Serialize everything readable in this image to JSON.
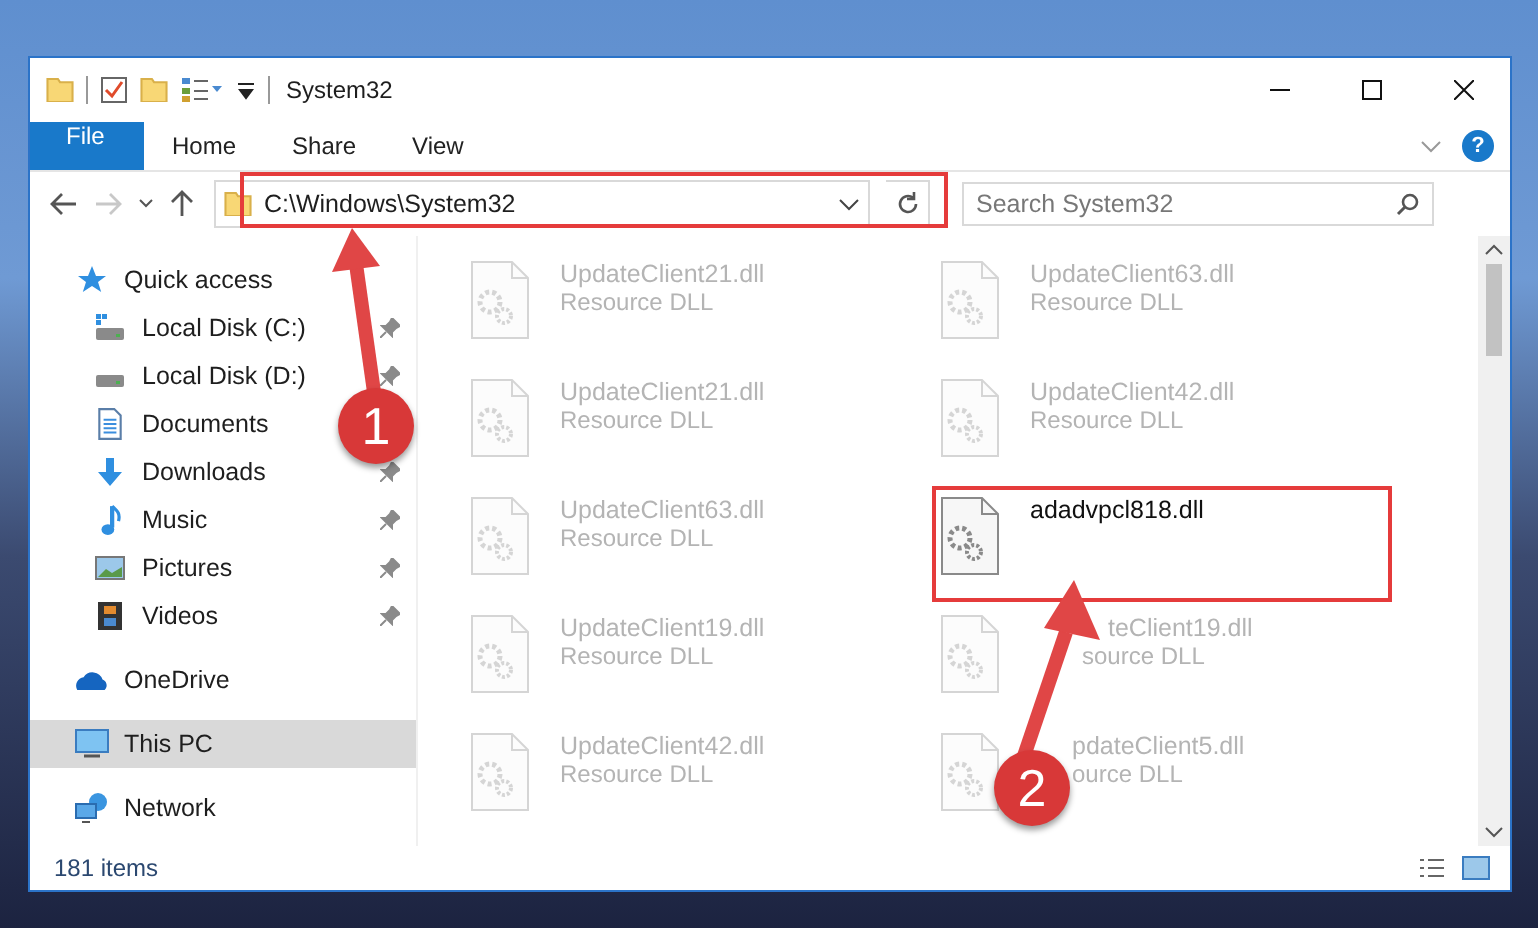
{
  "window": {
    "title": "System32"
  },
  "ribbon_tabs": [
    {
      "label": "File",
      "kind": "file-menu"
    },
    {
      "label": "Home",
      "kind": "tab"
    },
    {
      "label": "Share",
      "kind": "tab"
    },
    {
      "label": "View",
      "kind": "tab"
    }
  ],
  "help": "?",
  "address_bar": {
    "value": "C:\\Windows\\System32"
  },
  "search": {
    "placeholder": "Search System32"
  },
  "navigation": [
    {
      "label": "Quick access",
      "selected": false,
      "pinned": false,
      "children": [
        {
          "label": "Local Disk (C:)",
          "selected": false,
          "pinned": true
        },
        {
          "label": "Local Disk (D:)",
          "selected": false,
          "pinned": true
        },
        {
          "label": "Documents",
          "selected": false,
          "pinned": false
        },
        {
          "label": "Downloads",
          "selected": false,
          "pinned": true
        },
        {
          "label": "Music",
          "selected": false,
          "pinned": true
        },
        {
          "label": "Pictures",
          "selected": false,
          "pinned": true
        },
        {
          "label": "Videos",
          "selected": false,
          "pinned": true
        }
      ]
    },
    {
      "label": "OneDrive",
      "selected": false,
      "pinned": false
    },
    {
      "label": "This PC",
      "selected": true,
      "pinned": false
    },
    {
      "label": "Network",
      "selected": false,
      "pinned": false
    }
  ],
  "files": [
    {
      "name": "UpdateClient21.dll",
      "type": "Resource DLL",
      "blurred": true
    },
    {
      "name": "UpdateClient63.dll",
      "type": "Resource DLL",
      "blurred": true
    },
    {
      "name": "UpdateClient21.dll",
      "type": "Resource DLL",
      "blurred": true
    },
    {
      "name": "UpdateClient42.dll",
      "type": "Resource DLL",
      "blurred": true
    },
    {
      "name": "UpdateClient63.dll",
      "type": "Resource DLL",
      "blurred": true
    },
    {
      "name": "adadvpcl818.dll",
      "blurred": false
    },
    {
      "name": "UpdateClient19.dll",
      "type": "Resource DLL",
      "blurred": true
    },
    {
      "name": "teClient19.dll",
      "type": "source DLL",
      "blurred": true
    },
    {
      "name": "UpdateClient42.dll",
      "type": "Resource DLL",
      "blurred": true
    },
    {
      "name": "pdateClient5.dll",
      "type": "ource DLL",
      "blurred": true
    }
  ],
  "status_bar": {
    "item_count": "181 items"
  },
  "annotations": [
    {
      "number": "1"
    },
    {
      "number": "2"
    }
  ]
}
